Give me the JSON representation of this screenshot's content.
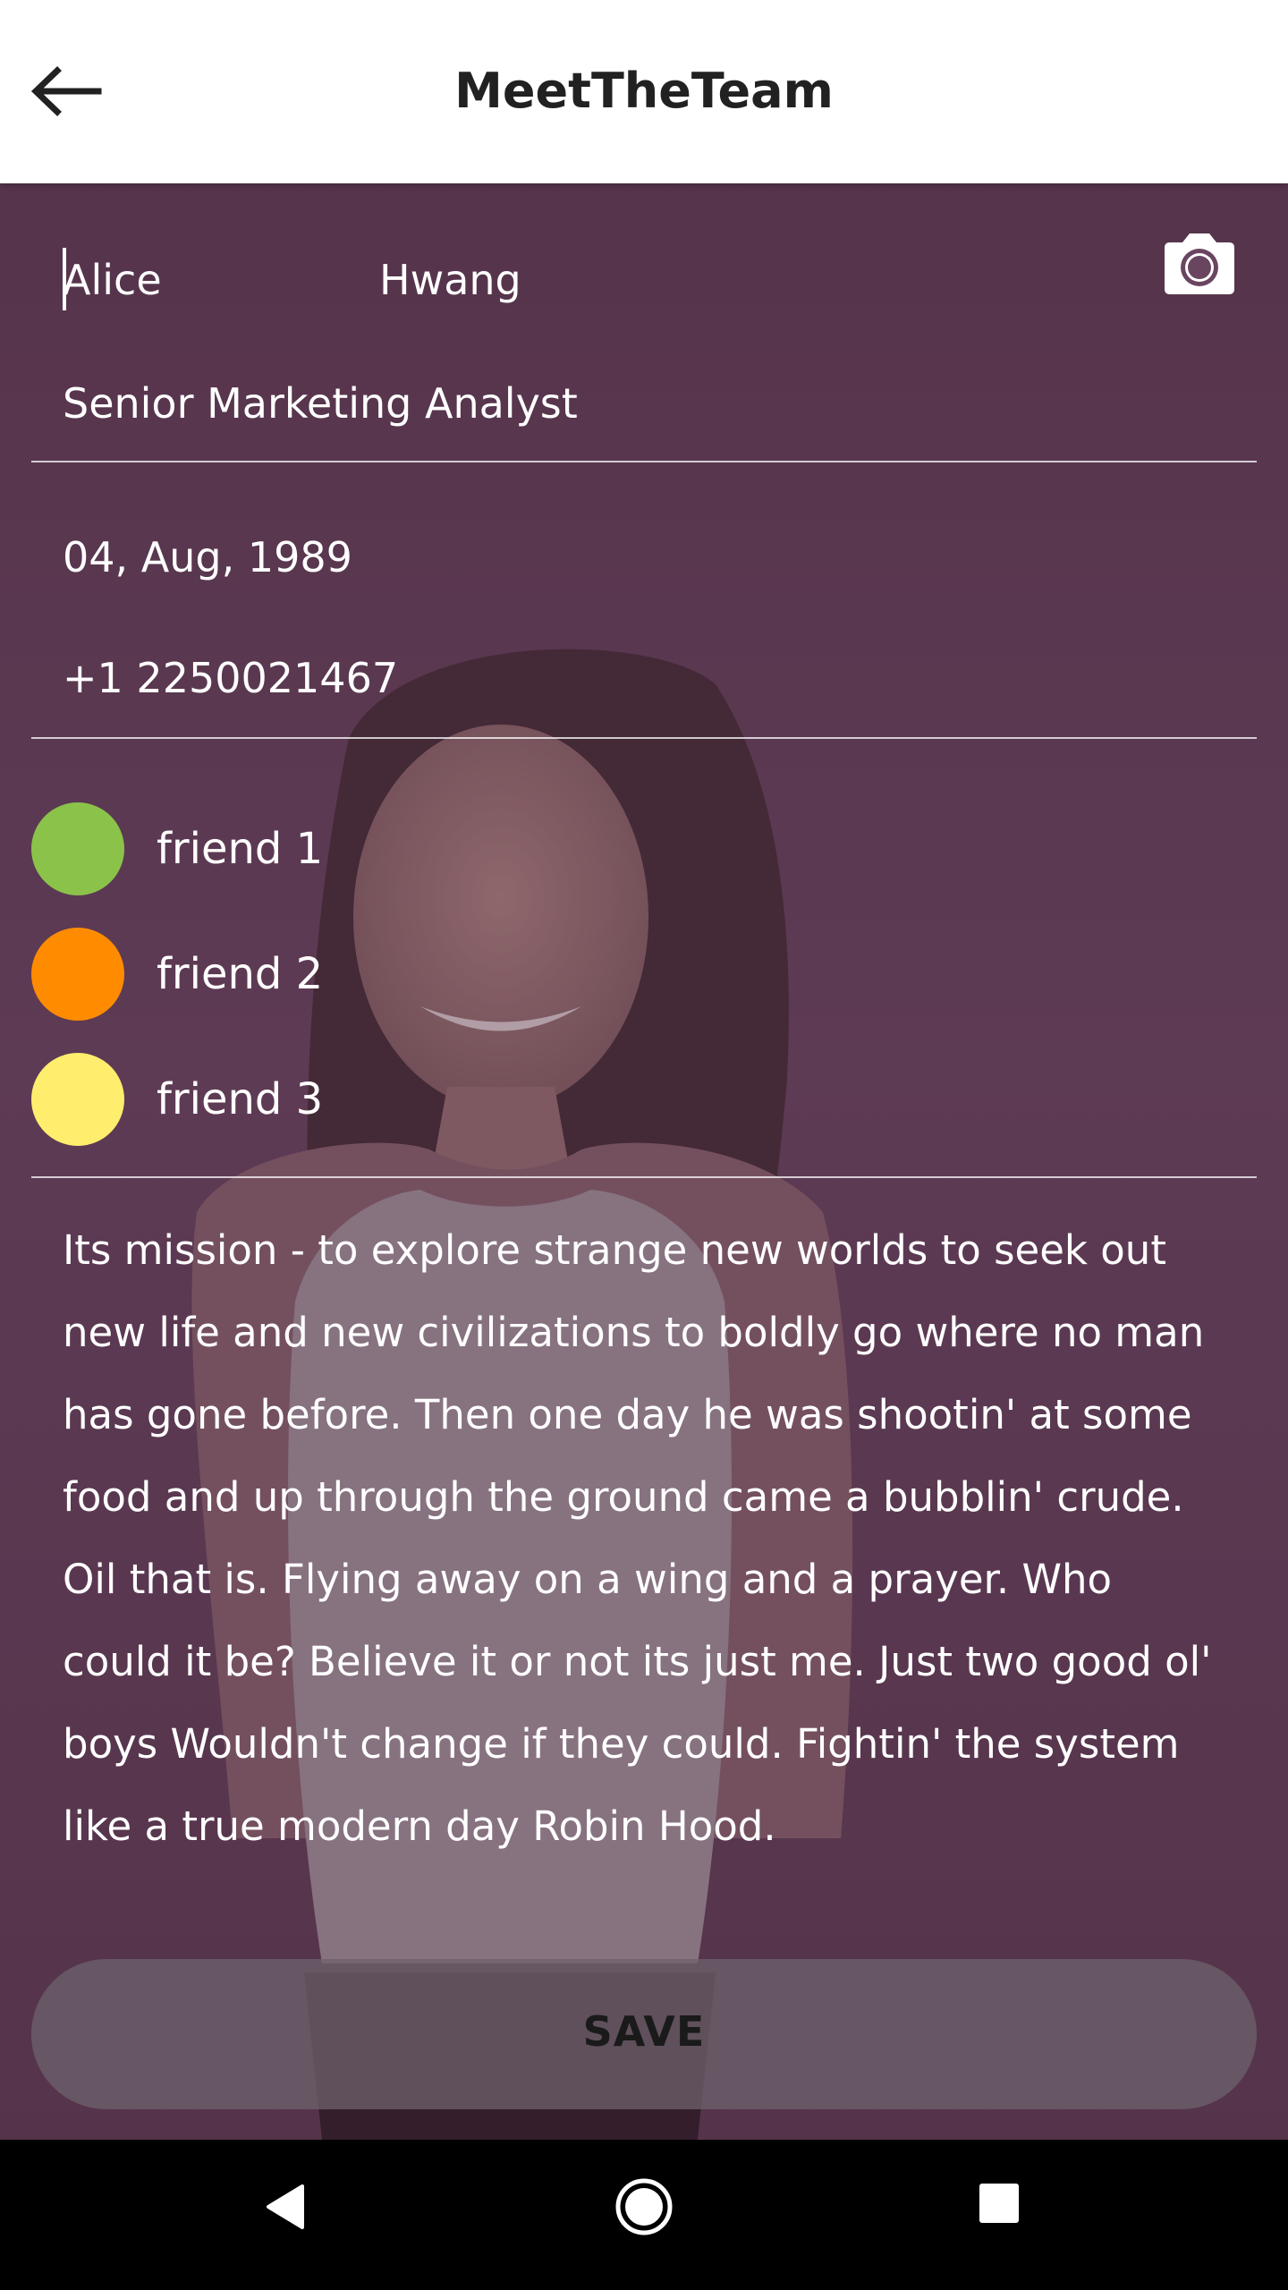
{
  "app_bar": {
    "title": "MeetTheTeam"
  },
  "profile": {
    "first_name": "Alice",
    "last_name": "Hwang",
    "job_title": "Senior Marketing Analyst",
    "birthday": "04, Aug, 1989",
    "phone": "+1 2250021467"
  },
  "friends": [
    {
      "label": "friend 1",
      "color": "#8bc34a"
    },
    {
      "label": "friend 2",
      "color": "#ff8c00"
    },
    {
      "label": "friend 3",
      "color": "#ffee6e"
    }
  ],
  "bio": "Its mission - to explore strange new worlds to seek out new life and new civilizations to boldly go where no man has gone before. Then one day he was shootin' at some food and up through the ground came a bubblin' crude. Oil that is. Flying away on a wing and a prayer. Who could it be? Believe it or not its just me. Just two good ol' boys Wouldn't change if they could. Fightin' the system like a true modern day Robin Hood.",
  "save_button": {
    "label": "SAVE"
  },
  "icons": {
    "back": "arrow-left-icon",
    "camera": "camera-icon",
    "nav_back": "triangle-back-icon",
    "nav_home": "circle-home-icon",
    "nav_recents": "square-recents-icon"
  }
}
